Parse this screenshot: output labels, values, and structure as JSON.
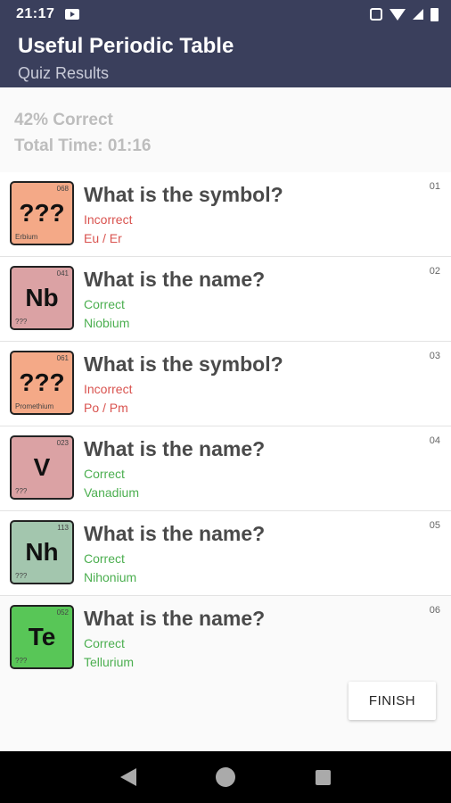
{
  "status": {
    "time": "21:17"
  },
  "header": {
    "title": "Useful Periodic Table",
    "subtitle": "Quiz Results"
  },
  "summary": {
    "percent": "42% Correct",
    "time": "Total Time: 01:16"
  },
  "items": [
    {
      "index": "01",
      "question": "What is the symbol?",
      "status": "Incorrect",
      "answer": "Eu / Er",
      "tile": {
        "number": "068",
        "symbol": "???",
        "name": "Erbium",
        "color": "#f4a987"
      },
      "status_color": "#d9534f"
    },
    {
      "index": "02",
      "question": "What is the name?",
      "status": "Correct",
      "answer": "Niobium",
      "tile": {
        "number": "041",
        "symbol": "Nb",
        "name": "???",
        "color": "#dba2a4"
      },
      "status_color": "#4caf50"
    },
    {
      "index": "03",
      "question": "What is the symbol?",
      "status": "Incorrect",
      "answer": "Po / Pm",
      "tile": {
        "number": "061",
        "symbol": "???",
        "name": "Promethium",
        "color": "#f4a987"
      },
      "status_color": "#d9534f"
    },
    {
      "index": "04",
      "question": "What is the name?",
      "status": "Correct",
      "answer": "Vanadium",
      "tile": {
        "number": "023",
        "symbol": "V",
        "name": "???",
        "color": "#dba2a4"
      },
      "status_color": "#4caf50"
    },
    {
      "index": "05",
      "question": "What is the name?",
      "status": "Correct",
      "answer": "Nihonium",
      "tile": {
        "number": "113",
        "symbol": "Nh",
        "name": "???",
        "color": "#a3c6ae"
      },
      "status_color": "#4caf50"
    },
    {
      "index": "06",
      "question": "What is the name?",
      "status": "Correct",
      "answer": "Tellurium",
      "tile": {
        "number": "052",
        "symbol": "Te",
        "name": "???",
        "color": "#58c657"
      },
      "status_color": "#4caf50"
    }
  ],
  "finish_label": "FINISH"
}
